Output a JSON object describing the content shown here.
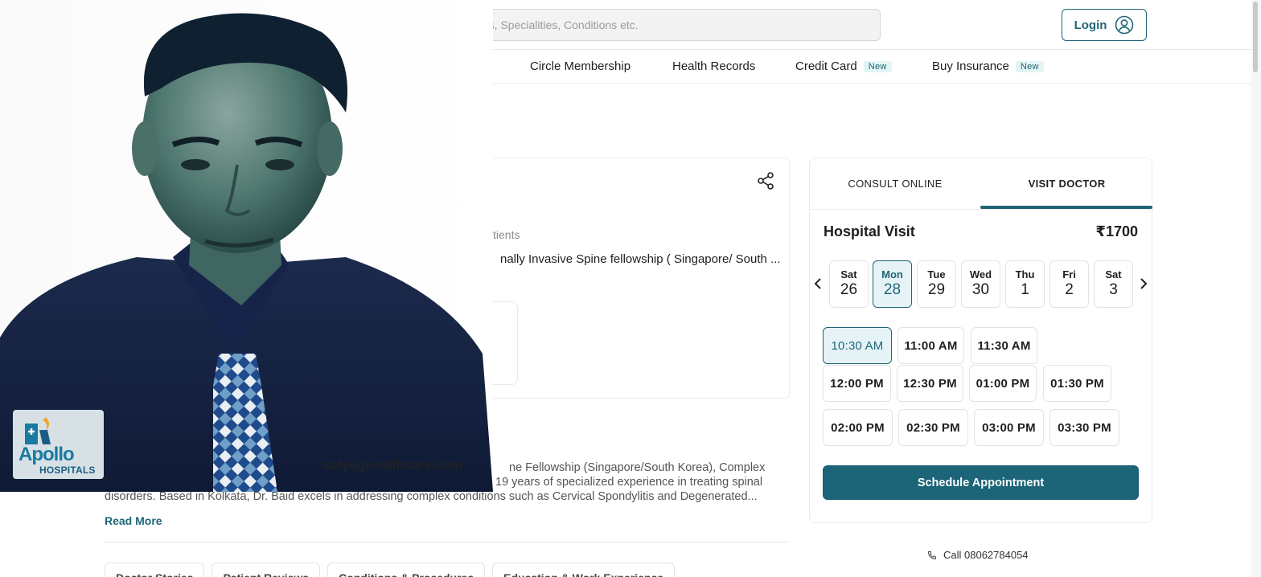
{
  "header": {
    "search_placeholder": "rs, Specialities, Conditions etc.",
    "login_label": "Login"
  },
  "nav": {
    "items": [
      {
        "label": "Circle Membership",
        "badge": ""
      },
      {
        "label": "Health Records",
        "badge": ""
      },
      {
        "label": "Credit Card",
        "badge": "New"
      },
      {
        "label": "Buy Insurance",
        "badge": "New"
      }
    ]
  },
  "doctor_card": {
    "patients_text": "tients",
    "qualification_text": "nally Invasive Spine fellowship ( Singapore/ South ..."
  },
  "about": {
    "lines": [
      "ne Fellowship (Singapore/South Korea), Complex",
      "19 years of specialized experience in treating spinal",
      "disorders. Based in Kolkata, Dr. Baid excels in addressing complex conditions such as Cervical Spondylitis and Degenerated..."
    ],
    "read_more": "Read More"
  },
  "section_tabs": [
    "Doctor Stories",
    "Patient Reviews",
    "Conditions & Procedures",
    "Education & Work Experience"
  ],
  "booking": {
    "tabs": [
      "CONSULT ONLINE",
      "VISIT DOCTOR"
    ],
    "active_tab": "VISIT DOCTOR",
    "title": "Hospital Visit",
    "price": "₹1700",
    "prev_icon": "chevron-left-icon",
    "next_icon": "chevron-right-icon",
    "days": [
      {
        "name": "Sat",
        "num": "26",
        "selected": false
      },
      {
        "name": "Mon",
        "num": "28",
        "selected": true
      },
      {
        "name": "Tue",
        "num": "29",
        "selected": false
      },
      {
        "name": "Wed",
        "num": "30",
        "selected": false
      },
      {
        "name": "Thu",
        "num": "1",
        "selected": false
      },
      {
        "name": "Fri",
        "num": "2",
        "selected": false
      },
      {
        "name": "Sat",
        "num": "3",
        "selected": false
      }
    ],
    "slots": [
      "10:30 AM",
      "11:00 AM",
      "11:30 AM",
      "12:00 PM",
      "12:30 PM",
      "01:00 PM",
      "01:30 PM",
      "02:00 PM",
      "02:30 PM",
      "03:00 PM",
      "03:30 PM"
    ],
    "selected_slot": "10:30 AM",
    "schedule_label": "Schedule Appointment"
  },
  "call": {
    "label": "Call 08062784054",
    "icon": "phone-icon"
  },
  "overlay": {
    "logo_text": "Apollo",
    "logo_sub": "HOSPITALS",
    "watermark": "satyughealthcare.com"
  },
  "colors": {
    "accent": "#1f6577",
    "selected_bg": "#e5f3f7",
    "button": "#1c6478"
  }
}
